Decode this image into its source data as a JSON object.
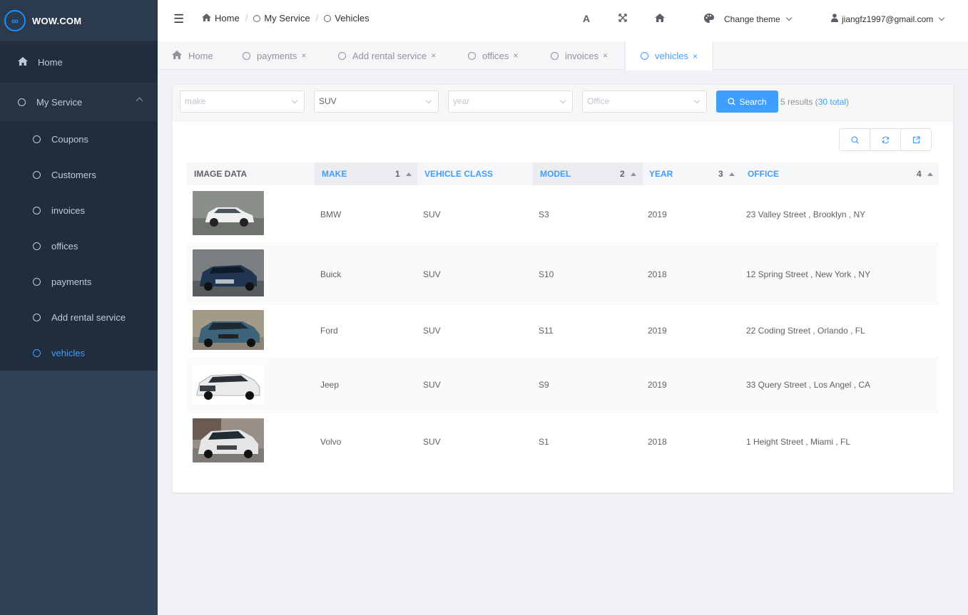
{
  "app": {
    "logo_text": "WOW.COM",
    "logo_glyph": "∞"
  },
  "sidebar": {
    "home": {
      "label": "Home",
      "icon": "home-icon"
    },
    "group": {
      "label": "My Service"
    },
    "items": [
      {
        "label": "Coupons"
      },
      {
        "label": "Customers"
      },
      {
        "label": "invoices"
      },
      {
        "label": "offices"
      },
      {
        "label": "payments"
      },
      {
        "label": "Add rental service"
      },
      {
        "label": "vehicles",
        "active": true
      }
    ]
  },
  "navbar": {
    "breadcrumb": [
      "Home",
      "My Service",
      "Vehicles"
    ],
    "theme_label": "Change theme",
    "user_email": "jiangfz1997@gmail.com"
  },
  "tags": [
    {
      "label": "Home"
    },
    {
      "label": "payments"
    },
    {
      "label": "Add rental service"
    },
    {
      "label": "offices"
    },
    {
      "label": "invoices"
    },
    {
      "label": "vehicles",
      "active": true
    }
  ],
  "filters": {
    "make": {
      "placeholder": "make"
    },
    "class": {
      "value": "SUV"
    },
    "year": {
      "placeholder": "year"
    },
    "office": {
      "placeholder": "Office"
    },
    "search_label": "Search",
    "results_prefix": "5 results (",
    "results_total": "30 total",
    "results_suffix": ")"
  },
  "table": {
    "headers": {
      "image": "IMAGE DATA",
      "make": "MAKE",
      "make_sort": "1",
      "vclass": "VEHICLE CLASS",
      "model": "MODEL",
      "model_sort": "2",
      "year": "YEAR",
      "year_sort": "3",
      "office": "OFFICE",
      "office_sort": "4"
    },
    "rows": [
      {
        "make": "BMW",
        "vclass": "SUV",
        "model": "S3",
        "year": "2019",
        "office": "23 Valley Street , Brooklyn , NY"
      },
      {
        "make": "Buick",
        "vclass": "SUV",
        "model": "S10",
        "year": "2018",
        "office": "12 Spring Street , New York , NY"
      },
      {
        "make": "Ford",
        "vclass": "SUV",
        "model": "S11",
        "year": "2019",
        "office": "22 Coding Street , Orlando , FL"
      },
      {
        "make": "Jeep",
        "vclass": "SUV",
        "model": "S9",
        "year": "2019",
        "office": "33 Query Street , Los Angel , CA"
      },
      {
        "make": "Volvo",
        "vclass": "SUV",
        "model": "S1",
        "year": "2018",
        "office": "1 Height Street , Miami , FL"
      }
    ]
  },
  "colors": {
    "accent": "#409eff",
    "sidebar": "#304156"
  }
}
